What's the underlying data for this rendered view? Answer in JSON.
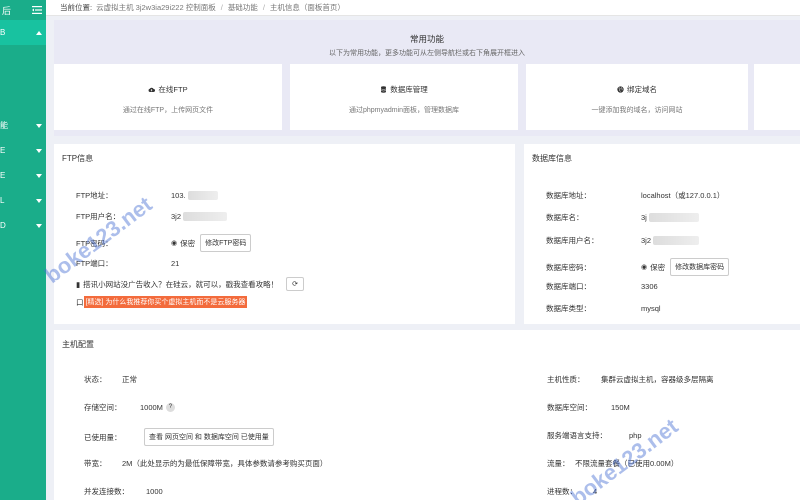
{
  "sidebar": {
    "top_label": "后",
    "items": [
      {
        "label": "B",
        "active": true
      },
      {
        "label": "能"
      },
      {
        "label": "E"
      },
      {
        "label": "E"
      },
      {
        "label": "L"
      },
      {
        "label": "D"
      }
    ]
  },
  "breadcrumb": {
    "prefix": "当前位置:",
    "site": "云虚拟主机 3j2w3ia29i222 控制面板",
    "parent": "基础功能",
    "current": "主机信息（面板首页）"
  },
  "common": {
    "title": "常用功能",
    "subtitle": "以下为常用功能，更多功能可从左侧导航栏或右下角展开框进入",
    "cards": [
      {
        "title": "在线FTP",
        "icon": "cloud-upload-icon",
        "desc": "通过在线FTP，上传网页文件"
      },
      {
        "title": "数据库管理",
        "icon": "database-icon",
        "desc": "通过phpmyadmin面板，管理数据库"
      },
      {
        "title": "绑定域名",
        "icon": "globe-icon",
        "desc": "一键添加我的域名，访问网站"
      }
    ]
  },
  "ftp": {
    "title": "FTP信息",
    "address_label": "FTP地址：",
    "address_value": "103.",
    "user_label": "FTP用户名：",
    "user_value": "3j2",
    "password_label": "FTP密码：",
    "password_value": "保密",
    "password_btn": "修改FTP密码",
    "port_label": "FTP端口：",
    "port_value": "21",
    "ad_text": "搭讯小网站没广告收入？在硅云，就可以，戳我查看攻略！",
    "promo_prefix": "口",
    "promo_text": "[精选] 为什么我推荐你买个虚拟主机而不是云服务器"
  },
  "db": {
    "title": "数据库信息",
    "address_label": "数据库地址：",
    "address_value": "localhost（或127.0.0.1）",
    "name_label": "数据库名：",
    "name_value": "3j",
    "user_label": "数据库用户名：",
    "user_value": "3j2",
    "password_label": "数据库密码：",
    "password_value": "保密",
    "password_btn": "修改数据库密码",
    "port_label": "数据库端口：",
    "port_value": "3306",
    "type_label": "数据库类型：",
    "type_value": "mysql"
  },
  "host": {
    "title": "主机配置",
    "status_label": "状态：",
    "status_value": "正常",
    "storage_label": "存储空间：",
    "storage_value": "1000M",
    "storage_help": "?",
    "used_label": "已使用量：",
    "used_btn": "查看 网页空间 和 数据库空间 已使用量",
    "bandwidth_label": "带宽：",
    "bandwidth_value": "2M（此处显示的为最低保障带宽，具体参数请参考购买页面）",
    "conn_label": "并发连接数：",
    "conn_value": "1000",
    "nature_label": "主机性质：",
    "nature_value": "集群云虚拟主机，容器级多层隔离",
    "dbspace_label": "数据库空间：",
    "dbspace_value": "150M",
    "lang_label": "服务端语言支持：",
    "lang_value": "php",
    "traffic_label": "流量：",
    "traffic_value": "不限流量套餐（已使用0.00M）",
    "proc_label": "进程数：",
    "proc_value": "4"
  },
  "watermark": {
    "text1": "boke123.net",
    "text2": "boke123.net"
  }
}
